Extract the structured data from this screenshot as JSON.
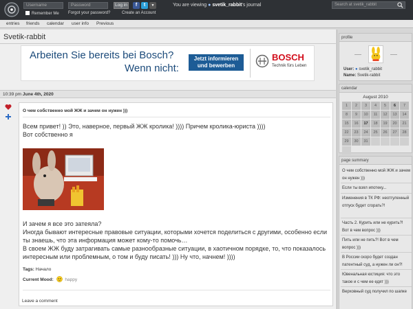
{
  "topbar": {
    "username_placeholder": "Username",
    "password_placeholder": "Password",
    "login_label": "Log in",
    "remember_label": "Remember Me",
    "forgot_label": "Forgot your password?",
    "create_label": "Create an Account",
    "viewing_prefix": "You are viewing",
    "viewing_user": "svetik_rabbit",
    "viewing_suffix": "'s journal",
    "search_placeholder": "Search at svetik_rabbit"
  },
  "nav": {
    "items": [
      "entries",
      "friends",
      "calendar",
      "user info",
      "Previous"
    ]
  },
  "journal_title": "Svetik-rabbit",
  "ad": {
    "line1": "Arbeiten Sie bereits bei Bosch?",
    "line2": "Wenn nicht:",
    "button": "Jetzt informieren und bewerben",
    "brand": "BOSCH",
    "tagline": "Technik fürs Leben"
  },
  "entry": {
    "time": "10:39 pm",
    "date": "June 4th, 2020",
    "subject": "О чем собственно мой ЖЖ и зачем он нужен )))",
    "intro": "Всем привет! )) Это, наверное, первый ЖЖ кролика! )))) Причем кролика-юриста ))))",
    "intro2": "Вот собственно я",
    "para1": "И зачем я все это затеяла?",
    "para2": "Иногда бывают интересные правовые ситуации, которыми хочется поделиться с другими, особенно если ты знаешь, что эта информация может кому-то помочь…",
    "para3": "В своем ЖЖ буду затрагивать самые разнообразные ситуации, в хаотичном порядке, то, что показалось интересным или проблемным, о том и буду писать! ))) Ну что, начнем! ))))",
    "tags_label": "Tags:",
    "tags_value": "Начало",
    "mood_label": "Current Mood:",
    "mood_value": "happy",
    "leave_comment": "Leave a comment"
  },
  "profile": {
    "header": "profile",
    "user_label": "User:",
    "user_value": "svetik_rabbit",
    "name_label": "Name:",
    "name_value": "Svetik-rabbit"
  },
  "calendar": {
    "header": "calendar",
    "month": "August 2010",
    "cells": [
      "1",
      "2",
      "3",
      "4",
      "5",
      "6",
      "7",
      "8",
      "9",
      "10",
      "11",
      "12",
      "13",
      "14",
      "15",
      "16",
      "17",
      "18",
      "19",
      "20",
      "21",
      "22",
      "23",
      "24",
      "25",
      "26",
      "27",
      "28",
      "29",
      "30",
      "31",
      "",
      "",
      "",
      "",
      ""
    ],
    "bold_days": [
      "6",
      "17"
    ]
  },
  "summary": {
    "header": "page summary",
    "items": [
      "О чем собственно мой ЖЖ и зачем он нужен )))",
      "Если ты взял ипотеку...",
      "Изменения в ТК РФ: неотгуленный отпуск будет сгорать?!",
      "Часть 2. Курить или не курить?! Вот в чем вопрос )))",
      "Пить или не пить?! Вот в чем вопрос )))",
      "В России скоро будет создан патентный суд, а нужен ли он?!",
      "Ювенальная юстиция: что это такое и с чем ее едят )))",
      "Верховный суд получил по шапке"
    ]
  }
}
